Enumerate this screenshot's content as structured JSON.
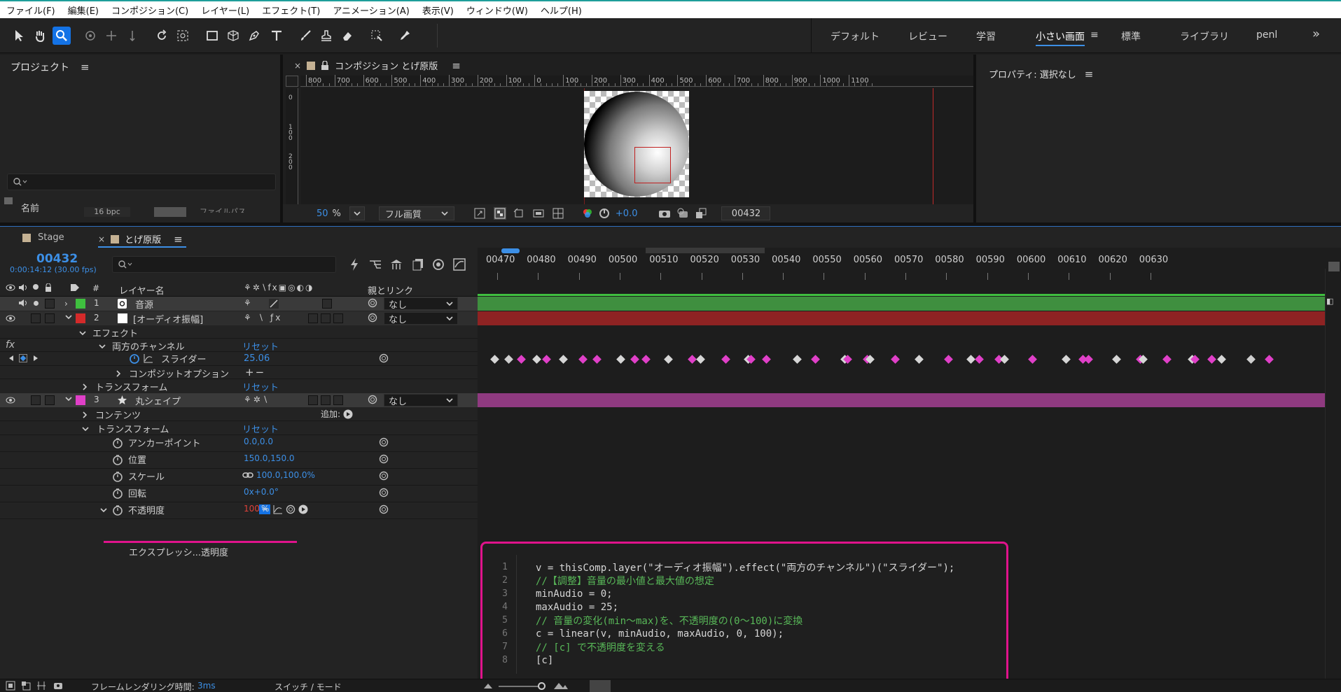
{
  "menu": [
    "ファイル(F)",
    "編集(E)",
    "コンポジション(C)",
    "レイヤー(L)",
    "エフェクト(T)",
    "アニメーション(A)",
    "表示(V)",
    "ウィンドウ(W)",
    "ヘルプ(H)"
  ],
  "workspaces": [
    "デフォルト",
    "レビュー",
    "学習",
    "小さい画面",
    "標準",
    "ライブラリ",
    "penl"
  ],
  "active_workspace": "小さい画面",
  "project": {
    "title": "プロジェクト",
    "search_placeholder": "",
    "col_name": "名前",
    "bpc": "16 bpc",
    "col_path": "ファイルパス"
  },
  "comp": {
    "tab_label": "コンポジション とげ原版",
    "ruler_labels": [
      "800",
      "700",
      "600",
      "500",
      "400",
      "300",
      "200",
      "100",
      "0",
      "100",
      "200",
      "300",
      "400",
      "500",
      "600",
      "700",
      "800",
      "900",
      "1000",
      "1100"
    ],
    "vruler_labels": [
      "0",
      "100",
      "200"
    ],
    "zoom": "50",
    "zoom_unit": "%",
    "quality": "フル画質",
    "exposure": "+0.0",
    "timecode": "00432"
  },
  "properties": {
    "title": "プロパティ: 選択なし"
  },
  "timeline": {
    "tabs": [
      {
        "label": "Stage"
      },
      {
        "label": "とげ原版"
      }
    ],
    "timecode": "00432",
    "timecode_sub": "0:00:14:12 (30.00 fps)",
    "search_placeholder": "",
    "headers": {
      "num": "#",
      "layer_name": "レイヤー名",
      "parent": "親とリンク"
    },
    "ticks": [
      "00470",
      "00480",
      "00490",
      "00500",
      "00510",
      "00520",
      "00530",
      "00540",
      "00550",
      "00560",
      "00570",
      "00580",
      "00590",
      "00600",
      "00610",
      "00620",
      "00630"
    ],
    "layers": [
      {
        "num": "1",
        "name": "音源",
        "parent": "なし",
        "color": "#3fbf3f",
        "bar": "#3f8f3f"
      },
      {
        "num": "2",
        "name": "[オーディオ振幅]",
        "parent": "なし",
        "color": "#d42a2a",
        "bar": "#8e2323"
      },
      {
        "num": "3",
        "name": "丸シェイプ",
        "parent": "なし",
        "color": "#e040c8",
        "bar": "#8f3a80"
      }
    ],
    "props": {
      "effects": "エフェクト",
      "both_channels": "両方のチャンネル",
      "reset": "リセット",
      "slider": "スライダー",
      "slider_value": "25.06",
      "composite": "コンポジットオプション",
      "transform": "トランスフォーム",
      "contents": "コンテンツ",
      "add": "追加:",
      "anchor": "アンカーポイント",
      "anchor_value": "0.0,0.0",
      "position": "位置",
      "position_value": "150.0,150.0",
      "scale": "スケール",
      "scale_value": "100.0,100.0%",
      "rotation": "回転",
      "rotation_value": "0x+0.0°",
      "opacity": "不透明度",
      "opacity_value": "100",
      "opacity_unit": "%",
      "expression": "エクスプレッシ...透明度"
    },
    "footer": {
      "render_label": "フレームレンダリング時間:",
      "render_value": "3ms",
      "switch_mode": "スイッチ / モード"
    }
  },
  "expression_code": [
    {
      "n": "1",
      "text": "v = thisComp.layer(\"オーディオ振幅\").effect(\"両方のチャンネル\")(\"スライダー\");"
    },
    {
      "n": "2",
      "text": "//【調整】音量の最小値と最大値の想定"
    },
    {
      "n": "3",
      "text": "minAudio = 0;"
    },
    {
      "n": "4",
      "text": "maxAudio = 25;"
    },
    {
      "n": "5",
      "text": "// 音量の変化(min〜max)を、不透明度の(0〜100)に変換"
    },
    {
      "n": "6",
      "text": "c = linear(v, minAudio, maxAudio, 0, 100);"
    },
    {
      "n": "7",
      "text": "// [c] で不透明度を変える"
    },
    {
      "n": "8",
      "text": "[c]"
    }
  ],
  "colors": {
    "accent": "#1473e6",
    "highlight": "#e0138c",
    "value_blue": "#3c8fe6",
    "opacity_red": "#e0413a"
  }
}
